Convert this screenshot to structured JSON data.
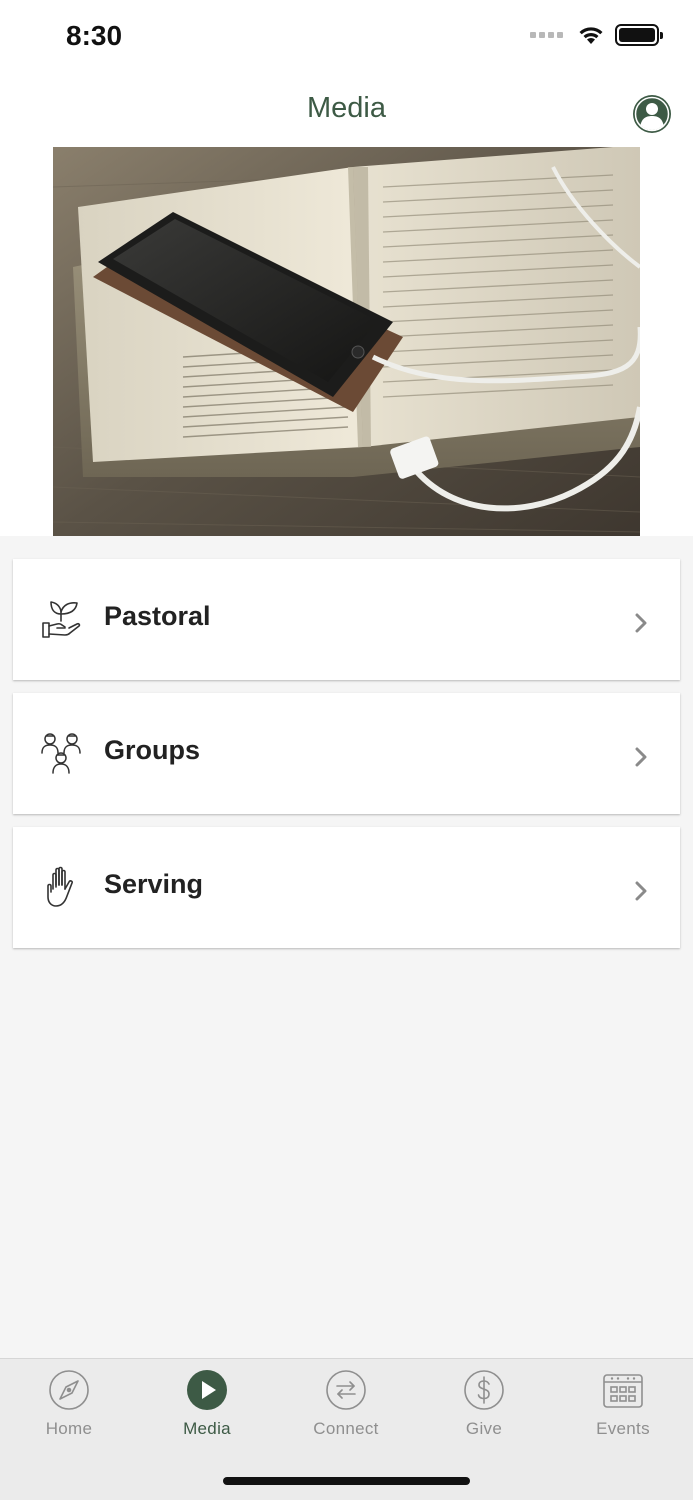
{
  "status_bar": {
    "time": "8:30"
  },
  "header": {
    "title": "Media"
  },
  "list": [
    {
      "label": "Pastoral",
      "icon": "hand-plant-icon"
    },
    {
      "label": "Groups",
      "icon": "group-people-icon"
    },
    {
      "label": "Serving",
      "icon": "raised-hand-icon"
    }
  ],
  "tabs": [
    {
      "label": "Home",
      "icon": "compass-icon",
      "active": false
    },
    {
      "label": "Media",
      "icon": "play-icon",
      "active": true
    },
    {
      "label": "Connect",
      "icon": "exchange-arrows-icon",
      "active": false
    },
    {
      "label": "Give",
      "icon": "dollar-icon",
      "active": false
    },
    {
      "label": "Events",
      "icon": "calendar-icon",
      "active": false
    }
  ],
  "colors": {
    "accent": "#3d5a45",
    "inactive": "#8f8f8f",
    "background": "#f5f5f5"
  }
}
